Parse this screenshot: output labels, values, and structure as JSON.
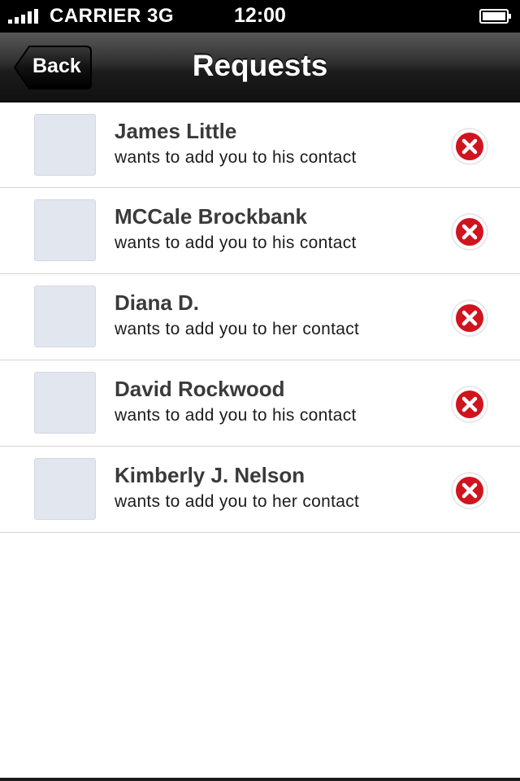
{
  "status_bar": {
    "carrier": "CARRIER",
    "network": "3G",
    "time": "12:00",
    "signal_icon": "signal-bars-icon",
    "battery_icon": "battery-full-icon"
  },
  "nav": {
    "back_label": "Back",
    "title": "Requests"
  },
  "requests": [
    {
      "name": "James Little",
      "message": "wants to add you to his contact"
    },
    {
      "name": "MCCale Brockbank",
      "message": "wants to add you to his contact"
    },
    {
      "name": "Diana D.",
      "message": "wants to add you to her contact"
    },
    {
      "name": "David Rockwood",
      "message": "wants to add you to his contact"
    },
    {
      "name": "Kimberly J. Nelson",
      "message": "wants to add you to her contact"
    }
  ],
  "colors": {
    "remove_red": "#d0141e",
    "avatar_placeholder": "#e2e6ee",
    "nav_dark": "#1c1c1c"
  }
}
